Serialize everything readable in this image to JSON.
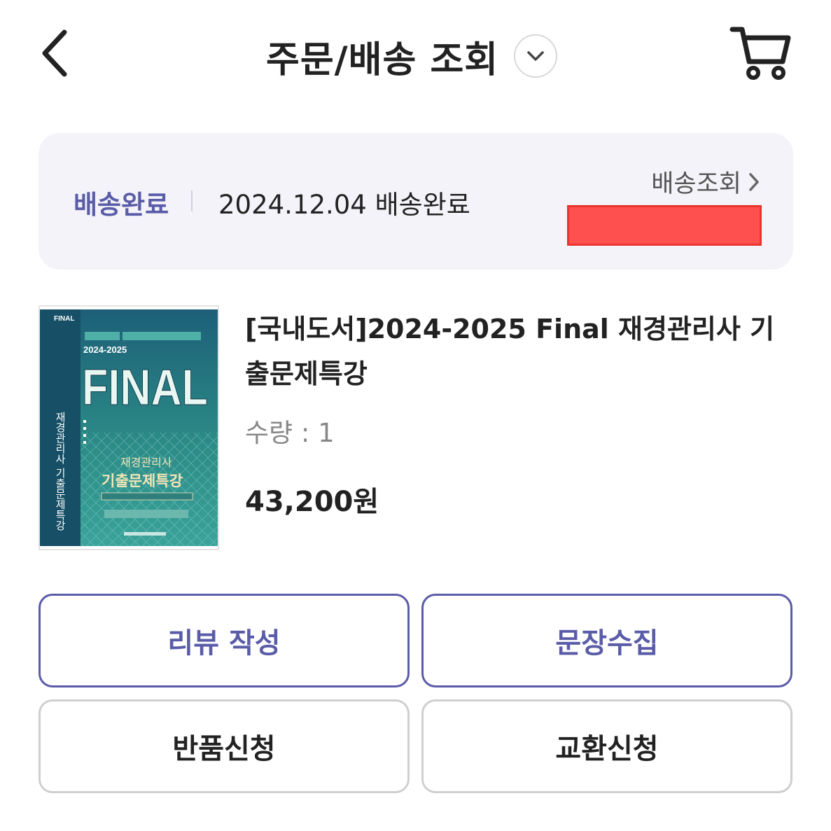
{
  "header": {
    "title": "주문/배송 조회",
    "back_icon": "chevron-left-icon",
    "dropdown_icon": "chevron-down-icon",
    "cart_icon": "cart-icon"
  },
  "delivery": {
    "status_label": "배송완료",
    "status_detail": "2024.12.04 배송완료",
    "track_label": "배송조회",
    "track_icon": "chevron-right-icon",
    "accent_color": "#5a5ca8"
  },
  "product": {
    "title": "[국내도서]2024-2025 Final 재경관리사 기출문제특강",
    "quantity": "수량 : 1",
    "price": "43,200원",
    "cover": {
      "series": "2024-2025",
      "big_title": "FINAL",
      "subtitle": "재경관리사",
      "main": "기출문제특강",
      "spine": "재경관리사 기출문제특강"
    }
  },
  "actions": {
    "review": "리뷰 작성",
    "collect": "문장수집",
    "return": "반품신청",
    "exchange": "교환신청"
  }
}
